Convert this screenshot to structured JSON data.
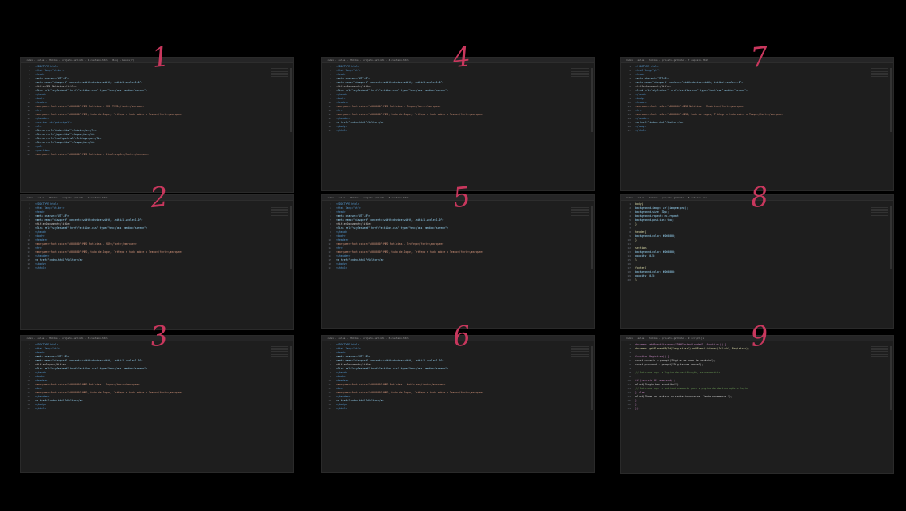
{
  "panels": [
    {
      "number": "1",
      "tab": "index · aulas · htmlbs · projeto-gatinho · 1 captain.html · Blog · Gatos(?)",
      "lines": [
        [
          "tag",
          "<!DOCTYPE html>"
        ],
        [
          "tag",
          "<html lang=\"pt-br\">"
        ],
        [
          "tag",
          "<head>"
        ],
        [
          "attr",
          "  <meta charset=\"UTF-8\">"
        ],
        [
          "attr",
          "  <meta name=\"viewport\" content=\"width=device-width, initial-scale=1.0\">"
        ],
        [
          "txt",
          "  <title>MRD Notícias</title>"
        ],
        [
          "attr",
          "  <link rel=\"stylesheet\" href=\"estilos.css\" type=\"text/css\" media=\"screen\">"
        ],
        [
          "tag",
          "</head>"
        ],
        [
          "tag",
          "<body>"
        ],
        [
          "tag",
          "<header>"
        ],
        [
          "str",
          "  <marquee><font color=\"#000000\">MRD Notícias - MRD TIME</font></marquee>"
        ],
        [
          "tag",
          "  <hr>"
        ],
        [
          "str",
          "  <marquee><font color=\"#000000\">MRD, tudo de Jogos, Tráfego e tudo sobre o Tempo</font></marquee>"
        ],
        [
          "tag",
          "</header>"
        ],
        [
          "tag",
          "<section id=\"principal\">"
        ],
        [
          "tag",
          "  <ul>"
        ],
        [
          "attr",
          "    <li><a href=\"index.html\">Início</a></li>"
        ],
        [
          "attr",
          "    <li><a href=\"jogos.html\">Jogos</a></li>"
        ],
        [
          "attr",
          "    <li><a href=\"trafego.html\">Tráfego</a></li>"
        ],
        [
          "attr",
          "    <li><a href=\"tempo.html\">Tempo</a></li>"
        ],
        [
          "tag",
          "  </ul>"
        ],
        [
          "tag",
          "</section>"
        ],
        [
          "str",
          "  <marquee><font color=\"#000000\">MRD Notícias - Atualização</font></marquee>"
        ]
      ]
    },
    {
      "number": "2",
      "tab": "index · aulas · htmlbs · projeto-gatinho · 2 captain.html",
      "lines": [
        [
          "tag",
          "<!DOCTYPE html>"
        ],
        [
          "tag",
          "<html lang=\"pt-br\">"
        ],
        [
          "tag",
          "<head>"
        ],
        [
          "attr",
          "  <meta charset=\"UTF-8\">"
        ],
        [
          "attr",
          "  <meta name=\"viewport\" content=\"width=device-width, initial-scale=1.0\">"
        ],
        [
          "txt",
          "  <title>Document</title>"
        ],
        [
          "attr",
          "  <link rel=\"stylesheet\" href=\"estilos.css\" type=\"text/css\" media=\"screen\">"
        ],
        [
          "tag",
          "</head>"
        ],
        [
          "tag",
          "<body>"
        ],
        [
          "tag",
          "<header>"
        ],
        [
          "str",
          "  <marquee><font color=\"#000000\">MRD Notícias - RDR</font></marquee>"
        ],
        [
          "tag",
          "  <hr>"
        ],
        [
          "str",
          "  <marquee><font color=\"#000000\">MRD, tudo de Jogos, Tráfego e tudo sobre o Tempo</font></marquee>"
        ],
        [
          "tag",
          "</header>"
        ],
        [
          "attr",
          "<a href=\"index.html\">Voltar</a>"
        ],
        [
          "tag",
          "</body>"
        ],
        [
          "tag",
          "</html>"
        ]
      ]
    },
    {
      "number": "3",
      "tab": "index · aulas · htmlbs · projeto-gatinho · 3 captain.html",
      "lines": [
        [
          "tag",
          "<!DOCTYPE html>"
        ],
        [
          "tag",
          "<html lang=\"pt\">"
        ],
        [
          "tag",
          "<head>"
        ],
        [
          "attr",
          "  <meta charset=\"UTF-8\">"
        ],
        [
          "attr",
          "  <meta name=\"viewport\" content=\"width=device-width, initial-scale=1.0\">"
        ],
        [
          "txt",
          "  <title>Jogos</title>"
        ],
        [
          "attr",
          "  <link rel=\"stylesheet\" href=\"estilos.css\" type=\"text/css\" media=\"screen\">"
        ],
        [
          "tag",
          "</head>"
        ],
        [
          "tag",
          "<body>"
        ],
        [
          "tag",
          "<header>"
        ],
        [
          "str",
          "  <marquee><font color=\"#000000\">MRD Notícias - Jogos</font></marquee>"
        ],
        [
          "tag",
          "  <hr>"
        ],
        [
          "str",
          "  <marquee><font color=\"#000000\">MRD, tudo de Jogos, Tráfego e tudo sobre o Tempo</font></marquee>"
        ],
        [
          "tag",
          "</header>"
        ],
        [
          "attr",
          "<a href=\"index.html\">Voltar</a>"
        ],
        [
          "tag",
          "</body>"
        ],
        [
          "tag",
          "</html>"
        ]
      ]
    },
    {
      "number": "4",
      "tab": "index · aulas · htmlbs · projeto-gatinho · 4 captain.html",
      "lines": [
        [
          "tag",
          "<!DOCTYPE html>"
        ],
        [
          "tag",
          "<html lang=\"pt\">"
        ],
        [
          "tag",
          "<head>"
        ],
        [
          "attr",
          "  <meta charset=\"UTF-8\">"
        ],
        [
          "attr",
          "  <meta name=\"viewport\" content=\"width=device-width, initial-scale=1.0\">"
        ],
        [
          "txt",
          "  <title>Document</title>"
        ],
        [
          "attr",
          "  <link rel=\"stylesheet\" href=\"estilos.css\" type=\"text/css\" media=\"screen\">"
        ],
        [
          "tag",
          "</head>"
        ],
        [
          "tag",
          "<body>"
        ],
        [
          "tag",
          "<header>"
        ],
        [
          "str",
          "  <marquee><font color=\"#000000\">MRD Notícias - Tempo</font></marquee>"
        ],
        [
          "tag",
          "  <hr>"
        ],
        [
          "str",
          "  <marquee><font color=\"#000000\">MRD, tudo de Jogos, Tráfego e tudo sobre o Tempo</font></marquee>"
        ],
        [
          "tag",
          "</header>"
        ],
        [
          "attr",
          "<a href=\"index.html\">Voltar</a>"
        ],
        [
          "tag",
          "</body>"
        ],
        [
          "tag",
          "</html>"
        ]
      ]
    },
    {
      "number": "5",
      "tab": "index · aulas · htmlbs · projeto-gatinho · 5 captain.html",
      "lines": [
        [
          "tag",
          "<!DOCTYPE html>"
        ],
        [
          "tag",
          "<html lang=\"pt\">"
        ],
        [
          "tag",
          "<head>"
        ],
        [
          "attr",
          "  <meta charset=\"UTF-8\">"
        ],
        [
          "attr",
          "  <meta name=\"viewport\" content=\"width=device-width, initial-scale=1.0\">"
        ],
        [
          "txt",
          "  <title>Document</title>"
        ],
        [
          "attr",
          "  <link rel=\"stylesheet\" href=\"estilos.css\" type=\"text/css\" media=\"screen\">"
        ],
        [
          "tag",
          "</head>"
        ],
        [
          "tag",
          "<body>"
        ],
        [
          "tag",
          "<header>"
        ],
        [
          "str",
          "  <marquee><font color=\"#000000\">MRD Notícias - Tráfego</font></marquee>"
        ],
        [
          "tag",
          "  <hr>"
        ],
        [
          "str",
          "  <marquee><font color=\"#000000\">MRD, tudo de Jogos, Tráfego e tudo sobre o Tempo</font></marquee>"
        ],
        [
          "tag",
          "</header>"
        ],
        [
          "attr",
          "<a href=\"index.html\">Voltar</a>"
        ],
        [
          "tag",
          "</body>"
        ],
        [
          "tag",
          "</html>"
        ]
      ]
    },
    {
      "number": "6",
      "tab": "index · aulas · htmlbs · projeto-gatinho · 6 captain.html",
      "lines": [
        [
          "tag",
          "<!DOCTYPE html>"
        ],
        [
          "tag",
          "<html lang=\"pt\">"
        ],
        [
          "tag",
          "<head>"
        ],
        [
          "attr",
          "  <meta charset=\"UTF-8\">"
        ],
        [
          "attr",
          "  <meta name=\"viewport\" content=\"width=device-width, initial-scale=1.0\">"
        ],
        [
          "txt",
          "  <title>Document</title>"
        ],
        [
          "attr",
          "  <link rel=\"stylesheet\" href=\"estilos.css\" type=\"text/css\" media=\"screen\">"
        ],
        [
          "tag",
          "</head>"
        ],
        [
          "tag",
          "<body>"
        ],
        [
          "tag",
          "<header>"
        ],
        [
          "str",
          "  <marquee><font color=\"#000000\">MRD Notícias - Notícias</font></marquee>"
        ],
        [
          "tag",
          "  <hr>"
        ],
        [
          "str",
          "  <marquee><font color=\"#000000\">MRD, tudo de Jogos, Tráfego e tudo sobre o Tempo</font></marquee>"
        ],
        [
          "tag",
          "</header>"
        ],
        [
          "attr",
          "<a href=\"index.html\">Voltar</a>"
        ],
        [
          "tag",
          "</body>"
        ],
        [
          "tag",
          "</html>"
        ]
      ]
    },
    {
      "number": "7",
      "tab": "index · aulas · htmlbs · projeto-gatinho · 7 captain.html",
      "lines": [
        [
          "tag",
          "<!DOCTYPE html>"
        ],
        [
          "tag",
          "<html lang=\"pt\">"
        ],
        [
          "tag",
          "<head>"
        ],
        [
          "attr",
          "  <meta charset=\"UTF-8\">"
        ],
        [
          "attr",
          "  <meta name=\"viewport\" content=\"width=device-width, initial-scale=1.0\">"
        ],
        [
          "txt",
          "  <title>Document</title>"
        ],
        [
          "attr",
          "  <link rel=\"stylesheet\" href=\"estilos.css\" type=\"text/css\" media=\"screen\">"
        ],
        [
          "tag",
          "</head>"
        ],
        [
          "tag",
          "<body>"
        ],
        [
          "tag",
          "<header>"
        ],
        [
          "str",
          "  <marquee><font color=\"#000000\">MRD Notícias - Memórias</font></marquee>"
        ],
        [
          "tag",
          "  <hr>"
        ],
        [
          "str",
          "  <marquee><font color=\"#000000\">MRD, tudo de Jogos, Tráfego e tudo sobre o Tempo</font></marquee>"
        ],
        [
          "tag",
          "</header>"
        ],
        [
          "attr",
          "<a href=\"index.html\">Voltar</a>"
        ],
        [
          "tag",
          "</body>"
        ],
        [
          "tag",
          "</html>"
        ]
      ]
    },
    {
      "number": "8",
      "tab": "index · aulas · htmlbs · projeto-gatinho · 8 estilos.css",
      "lines": [
        [
          "fn",
          "body{"
        ],
        [
          "attr",
          "  background-image: url(imagem.png);"
        ],
        [
          "attr",
          "  background-size: 30px;"
        ],
        [
          "attr",
          "  background-repeat: no-repeat;"
        ],
        [
          "attr",
          "  background-position: top;"
        ],
        [
          "fn",
          "}"
        ],
        [
          "txt",
          ""
        ],
        [
          "fn",
          "header{"
        ],
        [
          "attr",
          "  background-color: #000000;"
        ],
        [
          "fn",
          "}"
        ],
        [
          "txt",
          ""
        ],
        [
          "fn",
          "section{"
        ],
        [
          "attr",
          "  background-color: #000000;"
        ],
        [
          "attr",
          "  opacity: 0.5;"
        ],
        [
          "fn",
          "}"
        ],
        [
          "txt",
          ""
        ],
        [
          "fn",
          "footer{"
        ],
        [
          "attr",
          "  background-color: #000000;"
        ],
        [
          "attr",
          "  opacity: 0.5;"
        ],
        [
          "fn",
          "}"
        ]
      ]
    },
    {
      "number": "9",
      "tab": "index · aulas · htmlbs · projeto-gatinho · 9 script.js",
      "lines": [
        [
          "kw",
          "document.addEventListener(\"DOMContentLoaded\", function () {"
        ],
        [
          "fn",
          "  document.getElementById(\"registrar\").addEventListener(\"click\", Registrar);"
        ],
        [
          "txt",
          ""
        ],
        [
          "kw",
          "  function Registrar() {"
        ],
        [
          "txt",
          "    const usuario = prompt(\"Digite um nome de usuário\");"
        ],
        [
          "txt",
          "    const password = prompt(\"Digite uma senha\");"
        ],
        [
          "txt",
          ""
        ],
        [
          "cmt",
          "    // Adicione aqui a lógica de verificação, se necessário"
        ],
        [
          "txt",
          ""
        ],
        [
          "kw",
          "    if (usuario && password) {"
        ],
        [
          "txt",
          "      alert(\"Login bem-sucedido!\");"
        ],
        [
          "cmt",
          "      // Adicione aqui o redirecionamento para a página de destino após o login"
        ],
        [
          "kw",
          "    } else {"
        ],
        [
          "txt",
          "      alert(\"Nome de usuário ou senha incorretos. Tente novamente.\");"
        ],
        [
          "kw",
          "    }"
        ],
        [
          "kw",
          "  }"
        ],
        [
          "kw",
          "});"
        ]
      ]
    }
  ],
  "colors": {
    "background": "#000000",
    "editor_bg": "#1e1e1e",
    "number_ink": "#c8375d"
  }
}
